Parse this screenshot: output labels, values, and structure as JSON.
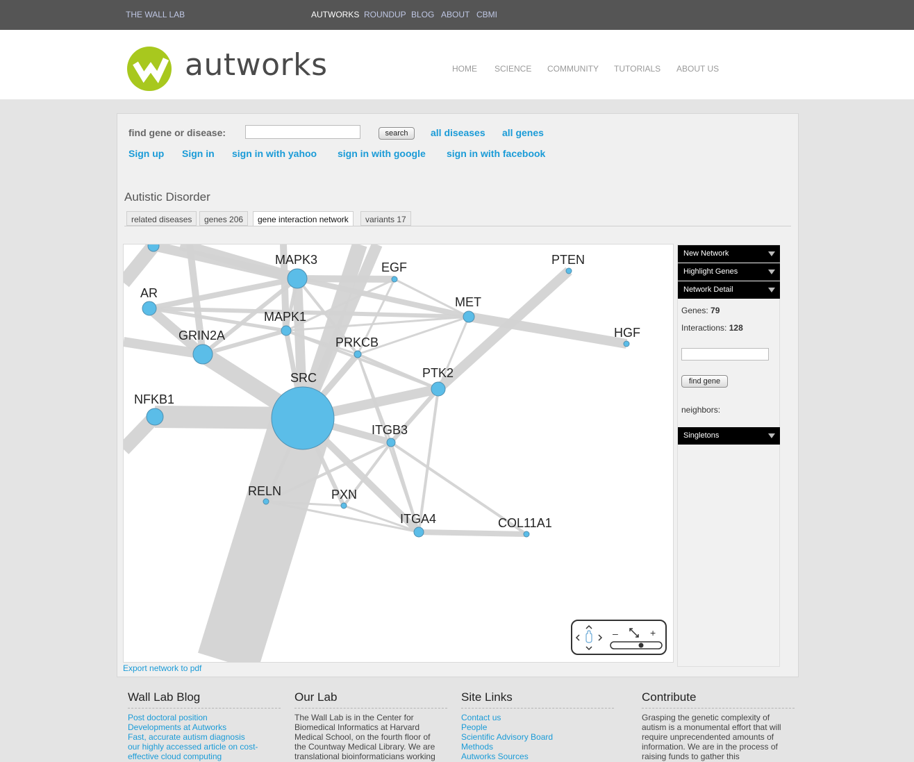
{
  "topbar": {
    "brand": "THE WALL LAB",
    "nav": [
      "AUTWORKS",
      "ROUNDUP",
      "BLOG",
      "ABOUT",
      "CBMI"
    ]
  },
  "header": {
    "logo_text": "autworks",
    "nav": [
      "HOME",
      "SCIENCE",
      "COMMUNITY",
      "TUTORIALS",
      "ABOUT US"
    ]
  },
  "search": {
    "label": "find gene or disease:",
    "value": "",
    "button": "search",
    "all_diseases": "all diseases",
    "all_genes": "all genes"
  },
  "auth": [
    "Sign up",
    "Sign in",
    "sign in with yahoo",
    "sign in with google",
    "sign in with facebook"
  ],
  "disease": {
    "title": "Autistic Disorder",
    "tabs": [
      "related diseases",
      "genes 206",
      "gene interaction network",
      "variants 17"
    ]
  },
  "network": {
    "nodes": [
      {
        "id": "TOPLEFT",
        "label": ""
      },
      {
        "id": "MAPK3",
        "label": "MAPK3"
      },
      {
        "id": "EGF",
        "label": "EGF"
      },
      {
        "id": "PTEN",
        "label": "PTEN"
      },
      {
        "id": "AR",
        "label": "AR"
      },
      {
        "id": "MET",
        "label": "MET"
      },
      {
        "id": "MAPK1",
        "label": "MAPK1"
      },
      {
        "id": "HGF",
        "label": "HGF"
      },
      {
        "id": "GRIN2A",
        "label": "GRIN2A"
      },
      {
        "id": "PRKCB",
        "label": "PRKCB"
      },
      {
        "id": "SRC",
        "label": "SRC"
      },
      {
        "id": "PTK2",
        "label": "PTK2"
      },
      {
        "id": "NFKB1",
        "label": "NFKB1"
      },
      {
        "id": "ITGB3",
        "label": "ITGB3"
      },
      {
        "id": "RELN",
        "label": "RELN"
      },
      {
        "id": "PXN",
        "label": "PXN"
      },
      {
        "id": "ITGA4",
        "label": "ITGA4"
      },
      {
        "id": "COL11A1",
        "label": "COL11A1"
      }
    ],
    "export_link": "Export network to pdf"
  },
  "panel": {
    "menus": [
      "New Network",
      "Highlight Genes",
      "Network Detail"
    ],
    "genes_label": "Genes:",
    "genes_count": "79",
    "interactions_label": "Interactions:",
    "interactions_count": "128",
    "gene_search_value": "",
    "find_button": "find gene",
    "neighbors_label": "neighbors:",
    "singletons": "Singletons"
  },
  "footer": {
    "blog": {
      "title": "Wall Lab Blog",
      "links": [
        "Post doctoral position",
        "Developments at Autworks",
        "Fast, accurate autism diagnosis",
        "our highly accessed article on cost-effective cloud computing"
      ]
    },
    "lab": {
      "title": "Our Lab",
      "text": "The Wall Lab is in the Center for Biomedical Informatics at Harvard Medical School, on the fourth floor of the Countway Medical Library. We are translational bioinformaticians working"
    },
    "sitelinks": {
      "title": "Site Links",
      "links": [
        "Contact us",
        "People",
        "Scientific Advisory Board",
        "Methods",
        "Autworks Sources"
      ]
    },
    "contribute": {
      "title": "Contribute",
      "text": "Grasping the genetic complexity of autism is a monumental effort that will require unprecendented amounts of information. We are in the process of raising funds to gather this"
    }
  },
  "colors": {
    "link": "#1a9bd7",
    "node_fill": "#5bbde8",
    "edge": "#d3d3d3",
    "logo_green": "#a8c81e"
  }
}
